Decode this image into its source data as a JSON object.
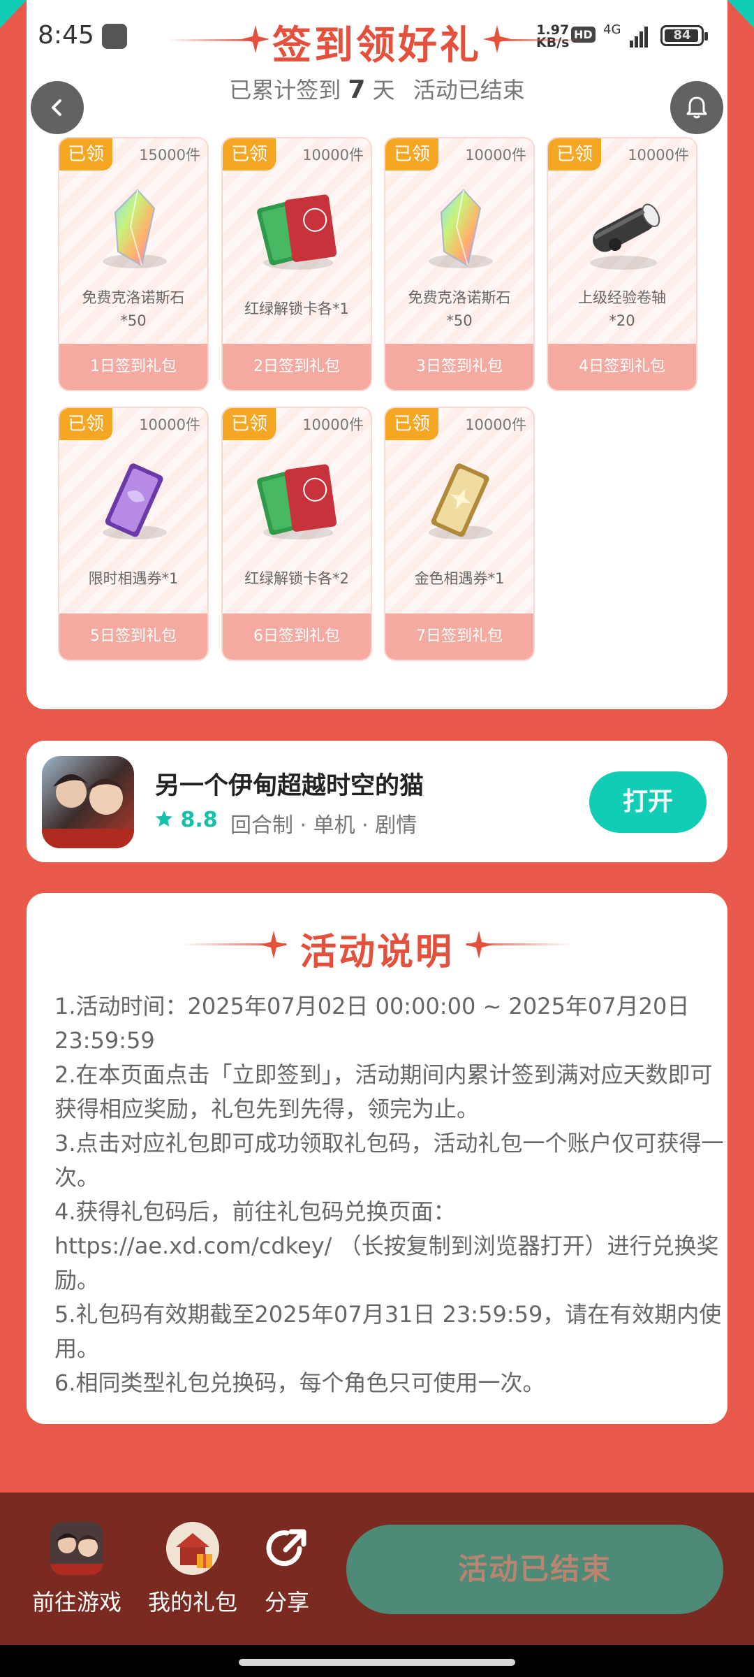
{
  "status_bar": {
    "time": "8:45",
    "net_speed_value": "1.97",
    "net_speed_unit": "KB/s",
    "hd_label": "HD",
    "network_label": "4G",
    "battery": "84"
  },
  "header": {
    "title": "签到领好礼",
    "subtitle_prefix": "已累计签到",
    "days": "7",
    "subtitle_suffix": "天",
    "status": "活动已结束"
  },
  "gifts": [
    {
      "claimed": "已领",
      "stock": "15000件",
      "name_line1": "免费克洛诺斯石",
      "name_line2": "*50",
      "button": "1日签到礼包",
      "icon": "rainbow-crystal-icon"
    },
    {
      "claimed": "已领",
      "stock": "10000件",
      "name_line1": "红绿解锁卡各*1",
      "name_line2": "",
      "button": "2日签到礼包",
      "icon": "unlock-cards-icon"
    },
    {
      "claimed": "已领",
      "stock": "10000件",
      "name_line1": "免费克洛诺斯石",
      "name_line2": "*50",
      "button": "3日签到礼包",
      "icon": "rainbow-crystal-icon"
    },
    {
      "claimed": "已领",
      "stock": "10000件",
      "name_line1": "上级经验卷轴",
      "name_line2": "*20",
      "button": "4日签到礼包",
      "icon": "scroll-icon"
    },
    {
      "claimed": "已领",
      "stock": "10000件",
      "name_line1": "限时相遇券*1",
      "name_line2": "",
      "button": "5日签到礼包",
      "icon": "purple-ticket-icon"
    },
    {
      "claimed": "已领",
      "stock": "10000件",
      "name_line1": "红绿解锁卡各*2",
      "name_line2": "",
      "button": "6日签到礼包",
      "icon": "unlock-cards-icon"
    },
    {
      "claimed": "已领",
      "stock": "10000件",
      "name_line1": "金色相遇券*1",
      "name_line2": "",
      "button": "7日签到礼包",
      "icon": "gold-ticket-icon"
    }
  ],
  "game": {
    "name": "另一个伊甸超越时空的猫",
    "rating": "8.8",
    "tags": "回合制 · 单机 · 剧情",
    "open_label": "打开"
  },
  "rules": {
    "title": "活动说明",
    "lines": [
      "1.活动时间：2025年07月02日 00:00:00 ~ 2025年07月20日 23:59:59",
      "2.在本页面点击「立即签到」，活动期间内累计签到满对应天数即可获得相应奖励，礼包先到先得，领完为止。",
      "3.点击对应礼包即可成功领取礼包码，活动礼包一个账户仅可获得一次。",
      "4.获得礼包码后，前往礼包码兑换页面：https://ae.xd.com/cdkey/ （长按复制到浏览器打开）进行兑换奖励。",
      "5.礼包码有效期截至2025年07月31日 23:59:59，请在有效期内使用。",
      "6.相同类型礼包兑换码，每个角色只可使用一次。"
    ]
  },
  "bottom": {
    "go_game": "前往游戏",
    "my_gifts": "我的礼包",
    "share": "分享",
    "ended": "活动已结束"
  },
  "colors": {
    "background": "#e8594a",
    "title_red": "#e4503c",
    "claimed_orange": "#f5a623",
    "gift_button": "#f4aaa0",
    "open_teal": "#12cdb6",
    "bottom_bar": "#7b2a21",
    "ended_button": "#4d8a78"
  }
}
